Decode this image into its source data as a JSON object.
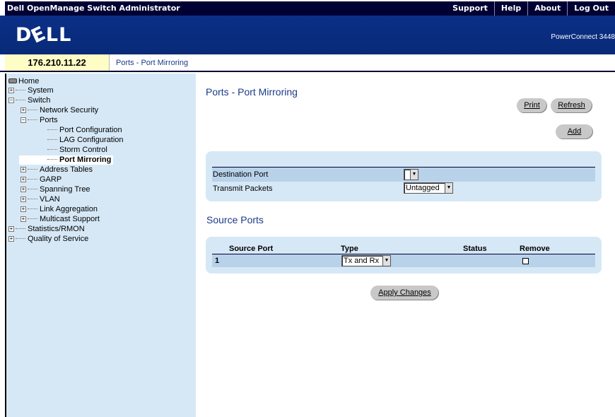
{
  "app": {
    "title": "Dell OpenManage Switch Administrator",
    "links": [
      "Support",
      "Help",
      "About",
      "Log Out"
    ],
    "logo": "D©LL",
    "model": "PowerConnect 3448"
  },
  "location": {
    "ip": "176.210.11.22",
    "breadcrumb": "Ports - Port Mirroring"
  },
  "nav": {
    "home": "Home",
    "system": "System",
    "switch": "Switch",
    "network_security": "Network Security",
    "ports": "Ports",
    "port_configuration": "Port Configuration",
    "lag_configuration": "LAG Configuration",
    "storm_control": "Storm Control",
    "port_mirroring": "Port Mirroring",
    "address_tables": "Address Tables",
    "garp": "GARP",
    "spanning_tree": "Spanning Tree",
    "vlan": "VLAN",
    "link_aggregation": "Link Aggregation",
    "multicast_support": "Multicast Support",
    "statistics_rmon": "Statistics/RMON",
    "quality_of_service": "Quality of Service"
  },
  "page": {
    "title": "Ports - Port Mirroring",
    "print_label": "Print",
    "refresh_label": "Refresh",
    "add_label": "Add",
    "destination_port_label": "Destination Port",
    "destination_port_value": "",
    "transmit_packets_label": "Transmit Packets",
    "transmit_packets_value": "Untagged",
    "source_ports_title": "Source Ports",
    "apply_label": "Apply Changes"
  },
  "source_table": {
    "headers": {
      "source_port": "Source Port",
      "type": "Type",
      "status": "Status",
      "remove": "Remove"
    },
    "rows": [
      {
        "index": "1",
        "source_port": "",
        "type": "Tx and Rx",
        "status": "",
        "remove": false
      }
    ]
  }
}
